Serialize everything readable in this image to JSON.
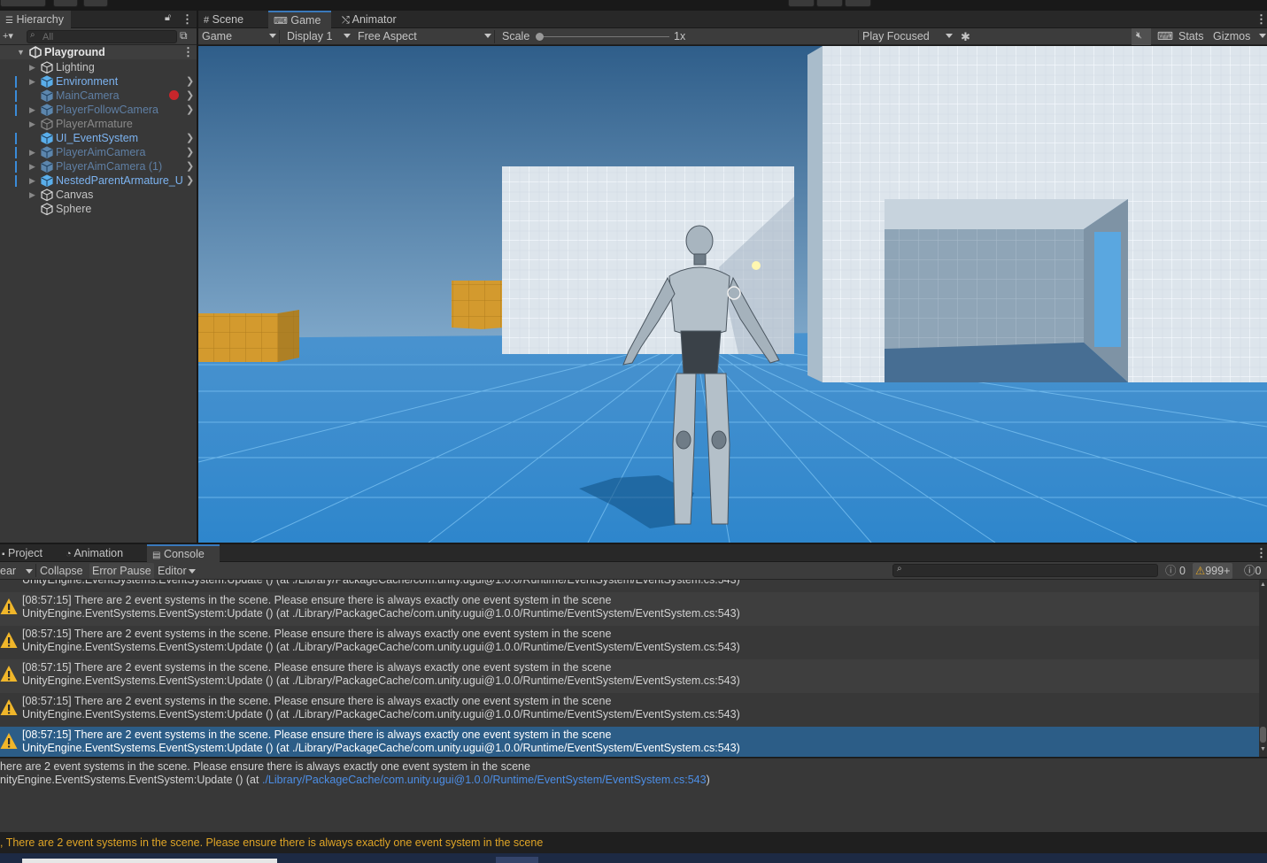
{
  "hierarchy": {
    "tab": "Hierarchy",
    "search_placeholder": "All",
    "scene": "Playground",
    "items": [
      {
        "label": "Lighting",
        "kind": "go",
        "arrow": true,
        "chev": false,
        "bar": false
      },
      {
        "label": "Environment",
        "kind": "prefab",
        "arrow": true,
        "chev": true,
        "bar": true
      },
      {
        "label": "MainCamera",
        "kind": "prefab-dim",
        "arrow": false,
        "chev": true,
        "bar": true,
        "badge": true
      },
      {
        "label": "PlayerFollowCamera",
        "kind": "prefab-dim",
        "arrow": true,
        "chev": true,
        "bar": true
      },
      {
        "label": "PlayerArmature",
        "kind": "dim",
        "arrow": true,
        "chev": false,
        "bar": false
      },
      {
        "label": "UI_EventSystem",
        "kind": "prefab",
        "arrow": false,
        "chev": true,
        "bar": true
      },
      {
        "label": "PlayerAimCamera",
        "kind": "prefab-dim",
        "arrow": true,
        "chev": true,
        "bar": true
      },
      {
        "label": "PlayerAimCamera (1)",
        "kind": "prefab-dim",
        "arrow": true,
        "chev": true,
        "bar": true
      },
      {
        "label": "NestedParentArmature_U",
        "kind": "prefab",
        "arrow": true,
        "chev": true,
        "bar": true
      },
      {
        "label": "Canvas",
        "kind": "go",
        "arrow": true,
        "chev": false,
        "bar": false
      },
      {
        "label": "Sphere",
        "kind": "go",
        "arrow": false,
        "chev": false,
        "bar": false
      }
    ]
  },
  "view_tabs": {
    "scene": "Scene",
    "game": "Game",
    "animator": "Animator"
  },
  "game_toolbar": {
    "mode": "Game",
    "display": "Display 1",
    "aspect": "Free Aspect",
    "scale_label": "Scale",
    "scale_value": "1x",
    "play_mode": "Play Focused",
    "stats": "Stats",
    "gizmos": "Gizmos"
  },
  "bottom_tabs": {
    "project": "Project",
    "animation": "Animation",
    "console": "Console"
  },
  "console_toolbar": {
    "clear": "ear",
    "collapse": "Collapse",
    "error_pause": "Error Pause",
    "editor": "Editor",
    "log_count": "0",
    "warn_count": "999+",
    "error_count": "0"
  },
  "console": {
    "partial_top": "UnityEngine.EventSystems.EventSystem:Update () (at ./Library/PackageCache/com.unity.ugui@1.0.0/Runtime/EventSystem/EventSystem.cs:543)",
    "entries": [
      {
        "l1": "[08:57:15] There are 2 event systems in the scene. Please ensure there is always exactly one event system in the scene",
        "l2": "UnityEngine.EventSystems.EventSystem:Update () (at ./Library/PackageCache/com.unity.ugui@1.0.0/Runtime/EventSystem/EventSystem.cs:543)"
      },
      {
        "l1": "[08:57:15] There are 2 event systems in the scene. Please ensure there is always exactly one event system in the scene",
        "l2": "UnityEngine.EventSystems.EventSystem:Update () (at ./Library/PackageCache/com.unity.ugui@1.0.0/Runtime/EventSystem/EventSystem.cs:543)"
      },
      {
        "l1": "[08:57:15] There are 2 event systems in the scene. Please ensure there is always exactly one event system in the scene",
        "l2": "UnityEngine.EventSystems.EventSystem:Update () (at ./Library/PackageCache/com.unity.ugui@1.0.0/Runtime/EventSystem/EventSystem.cs:543)"
      },
      {
        "l1": "[08:57:15] There are 2 event systems in the scene. Please ensure there is always exactly one event system in the scene",
        "l2": "UnityEngine.EventSystems.EventSystem:Update () (at ./Library/PackageCache/com.unity.ugui@1.0.0/Runtime/EventSystem/EventSystem.cs:543)"
      },
      {
        "l1": "[08:57:15] There are 2 event systems in the scene. Please ensure there is always exactly one event system in the scene",
        "l2": "UnityEngine.EventSystems.EventSystem:Update () (at ./Library/PackageCache/com.unity.ugui@1.0.0/Runtime/EventSystem/EventSystem.cs:543)"
      }
    ],
    "detail_line1": "here are 2 event systems in the scene. Please ensure there is always exactly one event system in the scene",
    "detail_line2_prefix": "nityEngine.EventSystems.EventSystem:Update () (at ",
    "detail_link": "./Library/PackageCache/com.unity.ugui@1.0.0/Runtime/EventSystem/EventSystem.cs:543",
    "detail_line2_suffix": ")"
  },
  "status_bar": ", There are 2 event systems in the scene. Please ensure there is always exactly one event system in the scene",
  "colors": {
    "accent": "#3a79bb",
    "selection": "#2c5d87",
    "warning": "#e0a526",
    "prefab": "#7cb3f0"
  }
}
